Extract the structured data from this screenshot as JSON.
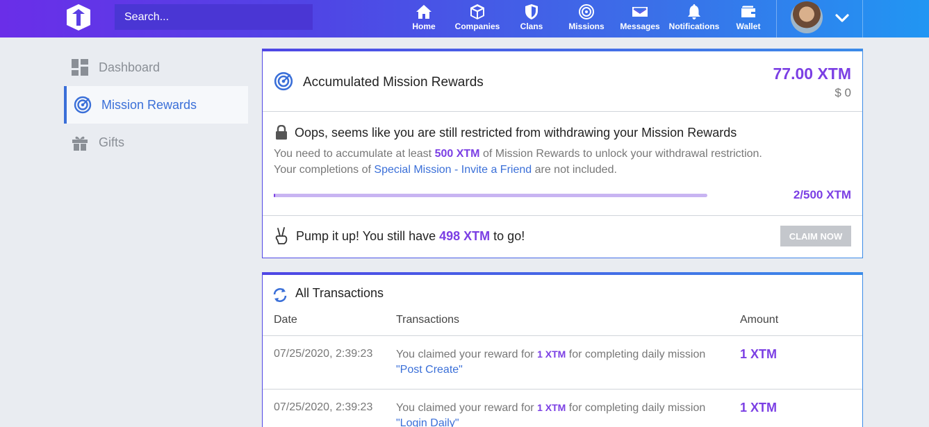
{
  "header": {
    "search_placeholder": "Search...",
    "nav": [
      {
        "label": "Home",
        "icon": "home-icon"
      },
      {
        "label": "Companies",
        "icon": "cube-icon"
      },
      {
        "label": "Clans",
        "icon": "shield-icon"
      },
      {
        "label": "Missions",
        "icon": "target-icon"
      },
      {
        "label": "Messages",
        "icon": "envelope-icon"
      },
      {
        "label": "Notifications",
        "icon": "bell-icon"
      },
      {
        "label": "Wallet",
        "icon": "wallet-icon"
      }
    ]
  },
  "sidebar": {
    "items": [
      {
        "label": "Dashboard",
        "icon": "dashboard-icon",
        "active": false
      },
      {
        "label": "Mission Rewards",
        "icon": "target-icon",
        "active": true
      },
      {
        "label": "Gifts",
        "icon": "gift-icon",
        "active": false
      }
    ]
  },
  "rewards": {
    "title": "Accumulated Mission Rewards",
    "amount": "77.00 XTM",
    "usd": "$ 0"
  },
  "restriction": {
    "title": "Oops, seems like you are still restricted from withdrawing your Mission Rewards",
    "line1_pre": "You need to accumulate at least ",
    "line1_highlight": "500 XTM",
    "line1_post": " of Mission Rewards to unlock your withdrawal restriction.",
    "line2_pre": "Your completions of ",
    "line2_link": "Special Mission - Invite a Friend",
    "line2_post": " are not included.",
    "progress_text": "2/500 XTM",
    "progress_fraction": 0.004
  },
  "pump": {
    "pre": "Pump it up! You still have ",
    "highlight": "498 XTM",
    "post": " to go!",
    "claim_label": "CLAIM NOW"
  },
  "transactions": {
    "title": "All Transactions",
    "columns": [
      "Date",
      "Transactions",
      "Amount"
    ],
    "rows": [
      {
        "date": "07/25/2020, 2:39:23",
        "pre": "You claimed your reward for ",
        "xtm": "1 XTM",
        "post": " for completing daily mission",
        "mission": "\"Post Create\"",
        "amount": "1 XTM"
      },
      {
        "date": "07/25/2020, 2:39:23",
        "pre": "You claimed your reward for ",
        "xtm": "1 XTM",
        "post": " for completing daily mission",
        "mission": "\"Login Daily\"",
        "amount": "1 XTM"
      }
    ]
  },
  "colors": {
    "accent": "#7b3fe4",
    "link": "#3a6fd8"
  }
}
